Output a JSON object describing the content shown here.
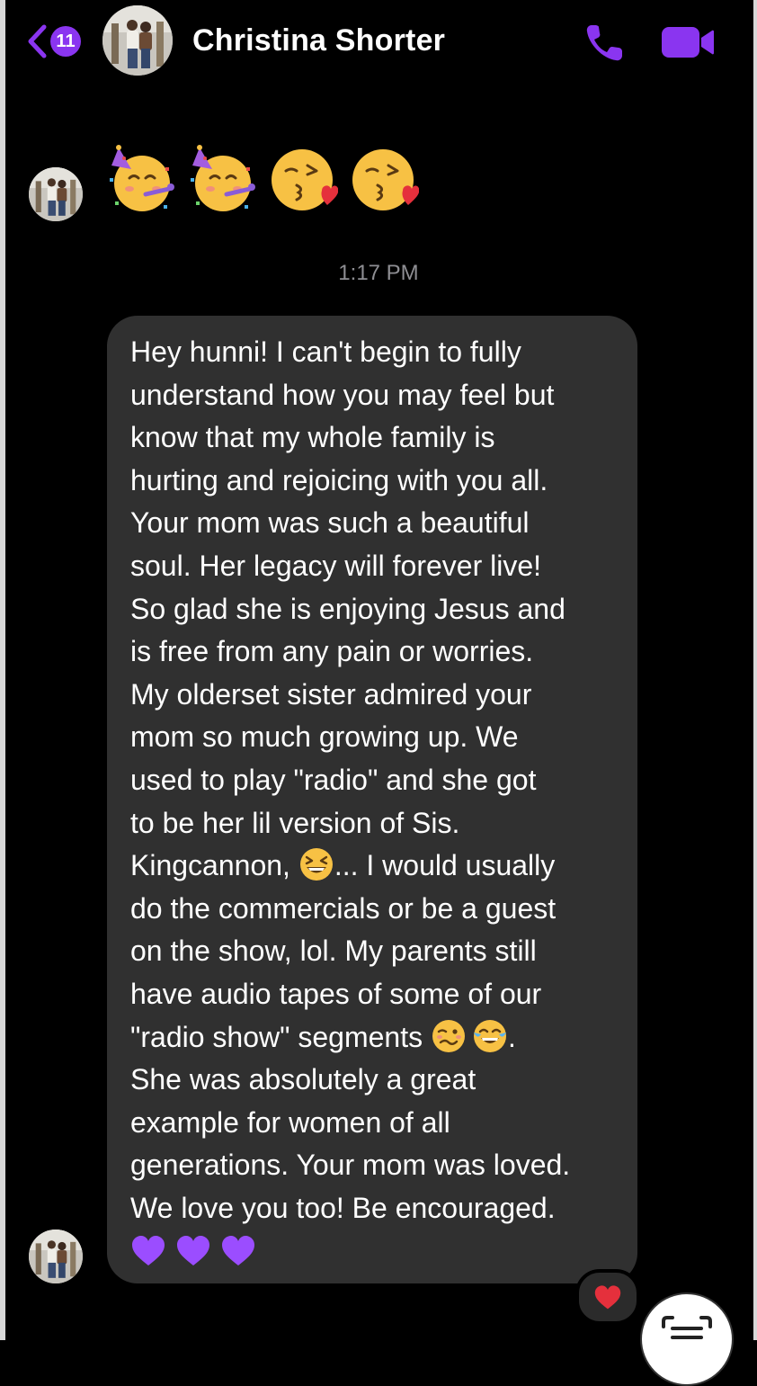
{
  "header": {
    "back_badge_count": "11",
    "contact_name": "Christina Shorter",
    "accent_color": "#8a35f0"
  },
  "icons": {
    "back": "chevron-left-icon",
    "phone": "phone-icon",
    "video": "video-camera-icon",
    "scan": "text-scan-icon"
  },
  "emoji_message": {
    "emojis": [
      "partying-face",
      "partying-face",
      "face-blowing-kiss",
      "face-blowing-kiss"
    ]
  },
  "timestamp": "1:17 PM",
  "message": {
    "lines": [
      "Hey hunni! I can't begin to fully",
      "understand how you may feel but",
      "know that my whole family is",
      "hurting and rejoicing with you all.",
      "Your mom was such a beautiful",
      "soul. Her legacy will forever live!",
      "So glad she is enjoying Jesus and",
      "is free from any pain or worries.",
      "My olderset sister admired your",
      "mom so much growing up. We",
      "used to play \"radio\" and she got",
      "to be her lil version of Sis."
    ],
    "line13_before": "Kingcannon, ",
    "line13_after": "... I would usually",
    "lines_b": [
      "do the commercials or be a guest",
      "on the show, lol. My parents still",
      "have audio tapes of some of our"
    ],
    "line17_before": "\"radio show\" segments ",
    "line17_after": ".",
    "lines_c": [
      "She was absolutely a great",
      "example for women of all",
      "generations. Your mom was loved.",
      "We love you too! Be encouraged."
    ],
    "inline_emojis": [
      "grinning-squinting-face",
      "woozy-face",
      "face-with-tears-of-joy"
    ],
    "heart_emojis": [
      "purple-heart",
      "purple-heart",
      "purple-heart"
    ]
  },
  "reaction": "red-heart",
  "colors": {
    "background": "#000000",
    "bubble": "#303030",
    "timestamp": "#8e8e93",
    "purple_heart": "#9b4dff"
  }
}
